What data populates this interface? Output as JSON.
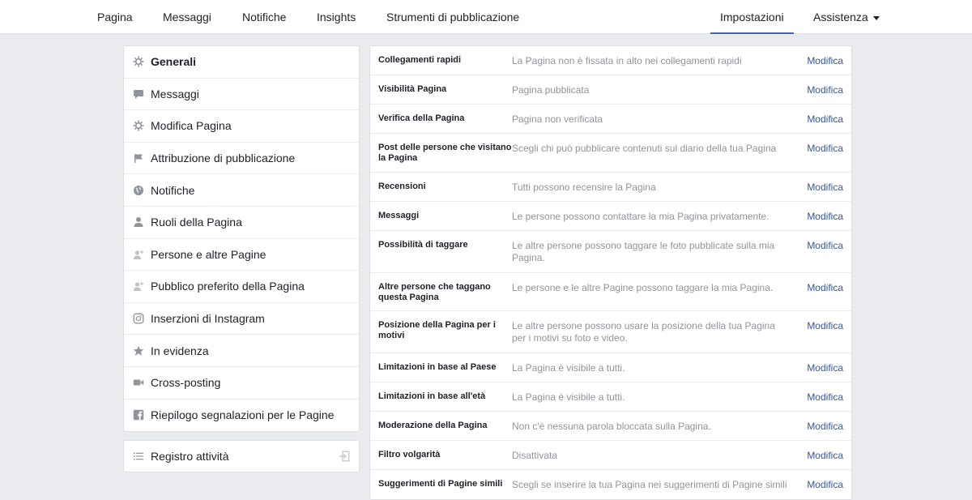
{
  "nav": {
    "left": [
      "Pagina",
      "Messaggi",
      "Notifiche",
      "Insights",
      "Strumenti di pubblicazione"
    ],
    "settings": "Impostazioni",
    "help": "Assistenza"
  },
  "sidebar": {
    "items": [
      {
        "label": "Generali",
        "icon": "gear-icon",
        "active": true
      },
      {
        "label": "Messaggi",
        "icon": "chat-icon"
      },
      {
        "label": "Modifica Pagina",
        "icon": "gear-icon"
      },
      {
        "label": "Attribuzione di pubblicazione",
        "icon": "flag-icon"
      },
      {
        "label": "Notifiche",
        "icon": "globe-icon"
      },
      {
        "label": "Ruoli della Pagina",
        "icon": "person-icon"
      },
      {
        "label": "Persone e altre Pagine",
        "icon": "person-plus-icon"
      },
      {
        "label": "Pubblico preferito della Pagina",
        "icon": "person-plus-icon"
      },
      {
        "label": "Inserzioni di Instagram",
        "icon": "instagram-icon"
      },
      {
        "label": "In evidenza",
        "icon": "star-icon"
      },
      {
        "label": "Cross-posting",
        "icon": "video-icon"
      },
      {
        "label": "Riepilogo segnalazioni per le Pagine",
        "icon": "facebook-icon"
      }
    ]
  },
  "activity_log": {
    "label": "Registro attività"
  },
  "settings": {
    "edit_label": "Modifica",
    "rows": [
      {
        "name": "Collegamenti rapidi",
        "value": "La Pagina non è fissata in alto nei collegamenti rapidi"
      },
      {
        "name": "Visibilità Pagina",
        "value": "Pagina pubblicata"
      },
      {
        "name": "Verifica della Pagina",
        "value": "Pagina non verificata"
      },
      {
        "name": "Post delle persone che visitano la Pagina",
        "value": "Scegli chi può pubblicare contenuti sul diario della tua Pagina"
      },
      {
        "name": "Recensioni",
        "value": "Tutti possono recensire la Pagina"
      },
      {
        "name": "Messaggi",
        "value": "Le persone possono contattare la mia Pagina privatamente."
      },
      {
        "name": "Possibilità di taggare",
        "value": "Le altre persone possono taggare le foto pubblicate sulla mia Pagina."
      },
      {
        "name": "Altre persone che taggano questa Pagina",
        "value": "Le persone e le altre Pagine possono taggare la mia Pagina."
      },
      {
        "name": "Posizione della Pagina per i motivi",
        "value": "Le altre persone possono usare la posizione della tua Pagina per i motivi su foto e video."
      },
      {
        "name": "Limitazioni in base al Paese",
        "value": "La Pagina è visibile a tutti."
      },
      {
        "name": "Limitazioni in base all'età",
        "value": "La Pagina è visibile a tutti."
      },
      {
        "name": "Moderazione della Pagina",
        "value": "Non c'è nessuna parola bloccata sulla Pagina."
      },
      {
        "name": "Filtro volgarità",
        "value": "Disattivata"
      },
      {
        "name": "Suggerimenti di Pagine simili",
        "value": "Scegli se inserire la tua Pagina nei suggerimenti di Pagine simili"
      }
    ]
  },
  "colors": {
    "link": "#365899",
    "accent": "#4267b2",
    "background": "#e9ebee",
    "muted_text": "#90949c"
  }
}
